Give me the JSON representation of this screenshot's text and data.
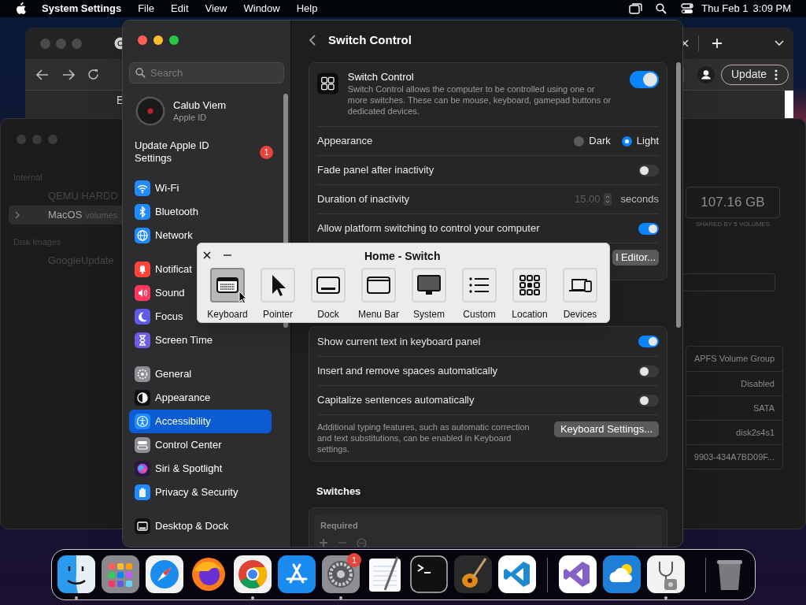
{
  "menu_bar": {
    "app": "System Settings",
    "menus": [
      "File",
      "Edit",
      "View",
      "Window",
      "Help"
    ],
    "date": "Thu Feb 1",
    "time": "3:09 PM"
  },
  "browser_window": {
    "bookmark": "E",
    "update_button": "Update"
  },
  "disk_utility": {
    "sidebar": [
      {
        "kind": "header",
        "label": "Internal",
        "selected": false
      },
      {
        "kind": "item",
        "label": "QEMU HARDD",
        "selected": false
      },
      {
        "kind": "volume",
        "label": "MacOS",
        "detail": "volumes",
        "selected": true
      },
      {
        "kind": "header",
        "label": "Disk Images",
        "selected": false
      },
      {
        "kind": "item",
        "label": "GoogleUpdate",
        "selected": false
      }
    ],
    "capacity": "107.16 GB",
    "capacity_caption": "SHARED BY 5 VOLUMES",
    "info_values": [
      "APFS Volume Group",
      "Disabled",
      "SATA",
      "disk2s4s1",
      "9903-434A7BD09F..."
    ]
  },
  "settings": {
    "search_placeholder": "Search",
    "account": {
      "name": "Calub Viem",
      "subtitle": "Apple ID"
    },
    "update_notice": {
      "label": "Update Apple ID Settings",
      "badge": "1"
    },
    "sidebar_groups": [
      {
        "items": [
          {
            "kind": "wifi",
            "label": "Wi-Fi",
            "selected": false
          },
          {
            "kind": "bluetooth",
            "label": "Bluetooth",
            "selected": false
          },
          {
            "kind": "network",
            "label": "Network",
            "selected": false
          }
        ]
      },
      {
        "items": [
          {
            "kind": "notifications",
            "label": "Notificat",
            "selected": false
          },
          {
            "kind": "sound",
            "label": "Sound",
            "selected": false
          },
          {
            "kind": "focus",
            "label": "Focus",
            "selected": false
          },
          {
            "kind": "screentime",
            "label": "Screen Time",
            "selected": false
          }
        ]
      },
      {
        "items": [
          {
            "kind": "general",
            "label": "General",
            "selected": false
          },
          {
            "kind": "appearance",
            "label": "Appearance",
            "selected": false
          },
          {
            "kind": "accessibility",
            "label": "Accessibility",
            "selected": true
          },
          {
            "kind": "controlcenter",
            "label": "Control Center",
            "selected": false
          },
          {
            "kind": "siri",
            "label": "Siri & Spotlight",
            "selected": false
          },
          {
            "kind": "privacy",
            "label": "Privacy & Security",
            "selected": false
          }
        ]
      },
      {
        "items": [
          {
            "kind": "desktop",
            "label": "Desktop & Dock",
            "selected": false
          }
        ]
      }
    ]
  },
  "switch_control": {
    "title": "Switch Control",
    "intro": {
      "title": "Switch Control",
      "description": "Switch Control allows the computer to be controlled using one or more switches. These can be mouse, keyboard, gamepad buttons or dedicated devices.",
      "on": true
    },
    "rows": [
      {
        "kind": "radio",
        "label": "Appearance",
        "options": [
          {
            "label": "Dark",
            "selected": false
          },
          {
            "label": "Light",
            "selected": true
          }
        ]
      },
      {
        "kind": "toggle",
        "label": "Fade panel after inactivity",
        "on": false
      },
      {
        "kind": "stepper",
        "label": "Duration of inactivity",
        "value": "15.00",
        "unit": "seconds",
        "disabled": true
      },
      {
        "kind": "toggle",
        "label": "Allow platform switching to control your computer",
        "on": true
      },
      {
        "kind": "button",
        "button": "l Editor..."
      }
    ],
    "typing_rows": [
      {
        "kind": "toggle",
        "label": "Show current text in keyboard panel",
        "on": true
      },
      {
        "kind": "toggle",
        "label": "Insert and remove spaces automatically",
        "on": false
      },
      {
        "kind": "toggle",
        "label": "Capitalize sentences automatically",
        "on": false
      },
      {
        "kind": "note",
        "text": "Additional typing features, such as automatic correction and text substitutions, can be enabled in Keyboard settings.",
        "button": "Keyboard Settings..."
      }
    ],
    "switches": {
      "title": "Switches",
      "header": "Required"
    }
  },
  "panel": {
    "title": "Home - Switch",
    "items": [
      {
        "kind": "keyboard",
        "label": "Keyboard",
        "selected": true
      },
      {
        "kind": "pointer",
        "label": "Pointer",
        "selected": false
      },
      {
        "kind": "dock",
        "label": "Dock",
        "selected": false
      },
      {
        "kind": "menubar",
        "label": "Menu Bar",
        "selected": false
      },
      {
        "kind": "system",
        "label": "System",
        "selected": false
      },
      {
        "kind": "custom",
        "label": "Custom",
        "selected": false
      },
      {
        "kind": "location",
        "label": "Location",
        "selected": false
      },
      {
        "kind": "devices",
        "label": "Devices",
        "selected": false
      }
    ]
  },
  "dock": {
    "groups": [
      {
        "items": [
          {
            "kind": "finder",
            "running": true
          },
          {
            "kind": "launchpad",
            "running": false
          },
          {
            "kind": "safari",
            "running": false
          },
          {
            "kind": "firefox",
            "running": false
          },
          {
            "kind": "chrome",
            "running": true
          },
          {
            "kind": "appstore",
            "running": false
          },
          {
            "kind": "settings",
            "running": true,
            "badge": "1"
          },
          {
            "kind": "textedit",
            "running": false
          },
          {
            "kind": "terminal",
            "running": false
          },
          {
            "kind": "garageband",
            "running": false
          },
          {
            "kind": "vscode",
            "running": false
          }
        ]
      },
      {
        "items": [
          {
            "kind": "visualstudio",
            "running": false
          },
          {
            "kind": "weather",
            "running": false
          },
          {
            "kind": "diskutility",
            "running": true
          }
        ]
      },
      {
        "items": [
          {
            "kind": "trash",
            "running": false
          }
        ]
      }
    ]
  }
}
